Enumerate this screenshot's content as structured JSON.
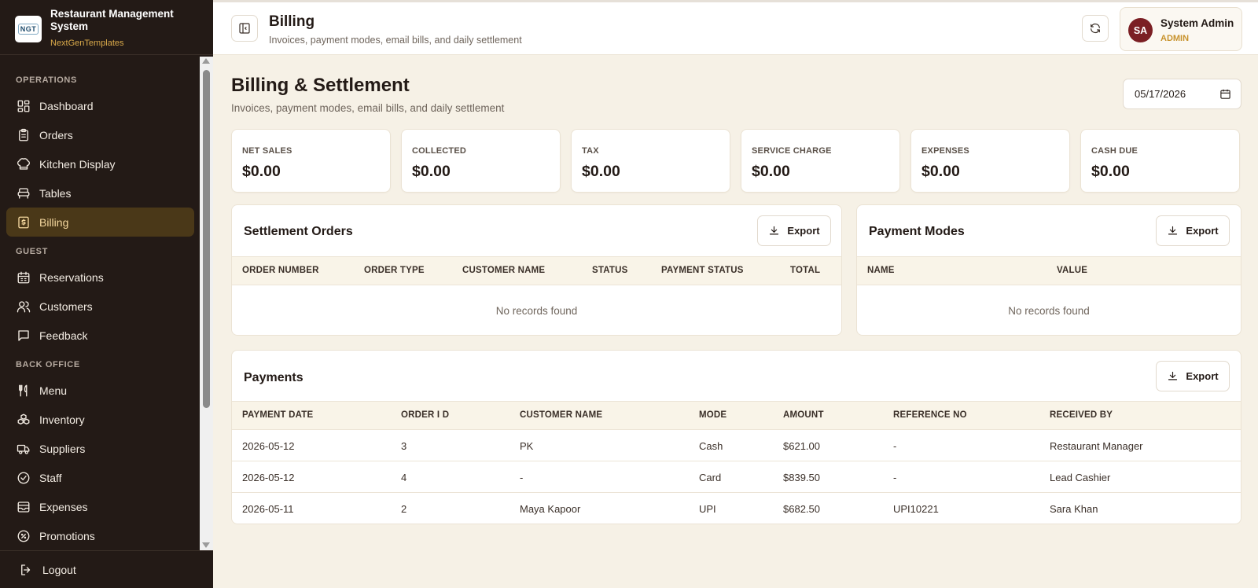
{
  "brand": {
    "logo_text": "NGT",
    "title": "Restaurant Management System",
    "subtitle": "NextGenTemplates"
  },
  "sidebar": {
    "sections": [
      "OPERATIONS",
      "GUEST",
      "BACK OFFICE"
    ],
    "items": [
      {
        "label": "Dashboard",
        "icon": "dashboard-icon"
      },
      {
        "label": "Orders",
        "icon": "clipboard-icon"
      },
      {
        "label": "Kitchen Display",
        "icon": "chef-hat-icon"
      },
      {
        "label": "Tables",
        "icon": "table-icon"
      },
      {
        "label": "Billing",
        "icon": "billing-icon",
        "active": true
      },
      {
        "label": "Reservations",
        "icon": "calendar-icon"
      },
      {
        "label": "Customers",
        "icon": "users-icon"
      },
      {
        "label": "Feedback",
        "icon": "message-icon"
      },
      {
        "label": "Menu",
        "icon": "utensils-icon"
      },
      {
        "label": "Inventory",
        "icon": "boxes-icon"
      },
      {
        "label": "Suppliers",
        "icon": "truck-icon"
      },
      {
        "label": "Staff",
        "icon": "badge-check-icon"
      },
      {
        "label": "Expenses",
        "icon": "wallet-icon"
      },
      {
        "label": "Promotions",
        "icon": "percent-icon"
      }
    ],
    "logout": "Logout"
  },
  "topbar": {
    "title": "Billing",
    "subtitle": "Invoices, payment modes, email bills, and daily settlement",
    "user": {
      "initials": "SA",
      "name": "System Admin",
      "role": "ADMIN"
    }
  },
  "page": {
    "title": "Billing & Settlement",
    "subtitle": "Invoices, payment modes, email bills, and daily settlement",
    "date": "05/17/2026"
  },
  "stats": [
    {
      "label": "NET SALES",
      "value": "$0.00"
    },
    {
      "label": "COLLECTED",
      "value": "$0.00"
    },
    {
      "label": "TAX",
      "value": "$0.00"
    },
    {
      "label": "SERVICE CHARGE",
      "value": "$0.00"
    },
    {
      "label": "EXPENSES",
      "value": "$0.00"
    },
    {
      "label": "CASH DUE",
      "value": "$0.00"
    }
  ],
  "settlement": {
    "title": "Settlement Orders",
    "export": "Export",
    "columns": [
      "ORDER NUMBER",
      "ORDER TYPE",
      "CUSTOMER NAME",
      "STATUS",
      "PAYMENT STATUS",
      "TOTAL"
    ],
    "empty": "No records found"
  },
  "modes": {
    "title": "Payment Modes",
    "export": "Export",
    "columns": [
      "NAME",
      "VALUE"
    ],
    "empty": "No records found"
  },
  "payments": {
    "title": "Payments",
    "export": "Export",
    "columns": [
      "PAYMENT DATE",
      "ORDER I D",
      "CUSTOMER NAME",
      "MODE",
      "AMOUNT",
      "REFERENCE NO",
      "RECEIVED BY"
    ],
    "rows": [
      [
        "2026-05-12",
        "3",
        "PK",
        "Cash",
        "$621.00",
        "-",
        "Restaurant Manager"
      ],
      [
        "2026-05-12",
        "4",
        "-",
        "Card",
        "$839.50",
        "-",
        "Lead Cashier"
      ],
      [
        "2026-05-11",
        "2",
        "Maya Kapoor",
        "UPI",
        "$682.50",
        "UPI10221",
        "Sara Khan"
      ]
    ]
  }
}
